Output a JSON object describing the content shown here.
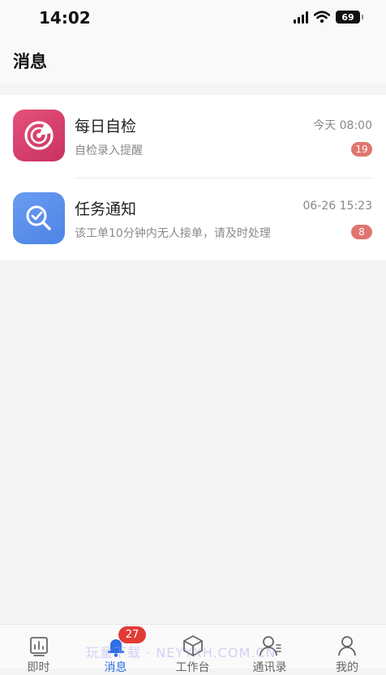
{
  "status_bar": {
    "time": "14:02",
    "battery": "69"
  },
  "header": {
    "title": "消息"
  },
  "messages": [
    {
      "title": "每日自检",
      "time": "今天 08:00",
      "subtitle": "自检录入提醒",
      "badge": "19",
      "icon": "radar-icon",
      "color": "#d63d6b"
    },
    {
      "title": "任务通知",
      "time": "06-26 15:23",
      "subtitle": "该工单10分钟内无人接单，请及时处理",
      "badge": "8",
      "icon": "search-check-icon",
      "color": "#5a8eea"
    }
  ],
  "tabbar": {
    "items": [
      {
        "label": "即时",
        "icon": "chart-icon"
      },
      {
        "label": "消息",
        "icon": "bell-icon",
        "badge": "27",
        "active": true
      },
      {
        "label": "工作台",
        "icon": "box-icon"
      },
      {
        "label": "通讯录",
        "icon": "contacts-icon"
      },
      {
        "label": "我的",
        "icon": "user-icon"
      }
    ]
  },
  "watermark": "玩童下载 · NEYYXH.COM.CN",
  "colors": {
    "accent": "#2f6fe6",
    "badge": "#e23b36",
    "item_badge": "#e0756f"
  }
}
